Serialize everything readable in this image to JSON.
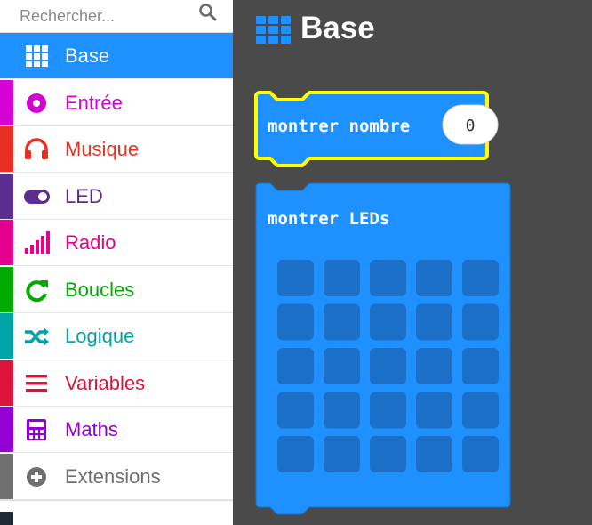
{
  "search": {
    "placeholder": "Rechercher..."
  },
  "toolbox": {
    "categories": [
      {
        "label": "Base",
        "color": "#1e90ff",
        "icon": "grid-icon",
        "selected": true
      },
      {
        "label": "Entrée",
        "color": "#d400d4",
        "icon": "target-icon",
        "selected": false
      },
      {
        "label": "Musique",
        "color": "#e63022",
        "icon": "headphones-icon",
        "selected": false
      },
      {
        "label": "LED",
        "color": "#5c2d91",
        "icon": "toggle-icon",
        "selected": false
      },
      {
        "label": "Radio",
        "color": "#e3008c",
        "icon": "signal-bars-icon",
        "selected": false
      },
      {
        "label": "Boucles",
        "color": "#00aa00",
        "icon": "refresh-icon",
        "selected": false
      },
      {
        "label": "Logique",
        "color": "#00a4a6",
        "icon": "shuffle-icon",
        "selected": false
      },
      {
        "label": "Variables",
        "color": "#dc143c",
        "icon": "list-icon",
        "selected": false
      },
      {
        "label": "Maths",
        "color": "#9400d3",
        "icon": "calculator-icon",
        "selected": false
      },
      {
        "label": "Extensions",
        "color": "#707070",
        "icon": "plus-circle-icon",
        "selected": false
      }
    ]
  },
  "flyout": {
    "title": "Base",
    "blocks": {
      "show_number": {
        "label": "montrer nombre",
        "value": "0"
      },
      "show_leds": {
        "label": "montrer LEDs"
      }
    }
  },
  "colors": {
    "block_fill": "#1e90ff",
    "block_border": "#1a72cc",
    "led_off": "#1c6fc7",
    "highlight": "#ffff00",
    "workspace": "#4a4a4a"
  }
}
